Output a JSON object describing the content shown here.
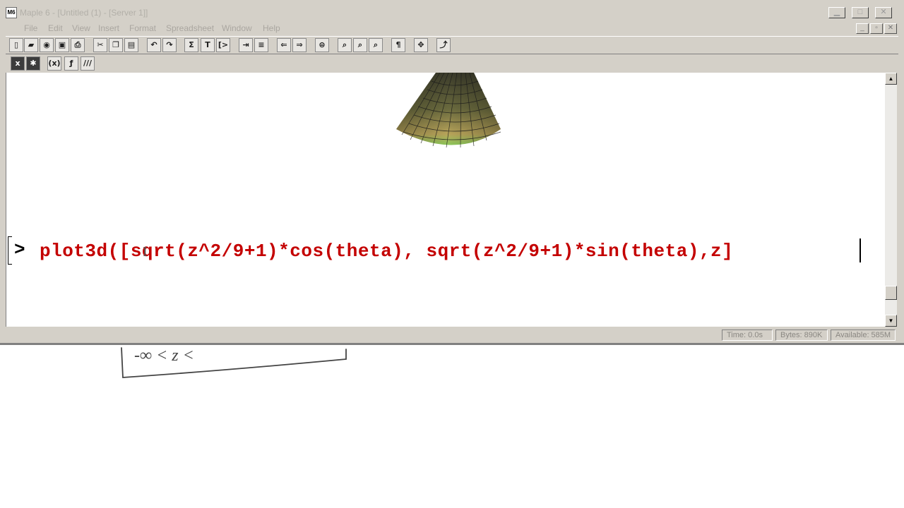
{
  "window": {
    "title": "Maple 6 - [Untitled (1) - [Server 1]]"
  },
  "menu": [
    "File",
    "Edit",
    "View",
    "Insert",
    "Format",
    "Spreadsheet",
    "Window",
    "Help"
  ],
  "document": {
    "prompt": ">",
    "command": "plot3d([sqrt(z^2/9+1)*cos(theta), sqrt(z^2/9+1)*sin(theta),z]"
  },
  "status": {
    "time": "Time: 0.0s",
    "bytes": "Bytes: 890K",
    "available": "Available: 585M"
  },
  "handwriting": {
    "text": "-∞ < z <"
  },
  "icons": {
    "toolbar1": [
      "new-icon",
      "open-icon",
      "open-url-icon",
      "save-icon",
      "print-icon",
      "cut-icon",
      "copy-icon",
      "paste-icon",
      "undo-icon",
      "redo-icon",
      "sigma-icon",
      "text-icon",
      "input-prompt-icon",
      "indent-icon",
      "outdent-icon",
      "back-icon",
      "forward-icon",
      "stop-icon",
      "zoom-100-icon",
      "zoom-150-icon",
      "zoom-200-icon",
      "paragraph-icon",
      "expand-icon",
      "restart-icon"
    ],
    "toolbar2": [
      "execute-icon",
      "debug-icon",
      "format-x-icon",
      "format-f-icon",
      "format-all-icon"
    ]
  }
}
